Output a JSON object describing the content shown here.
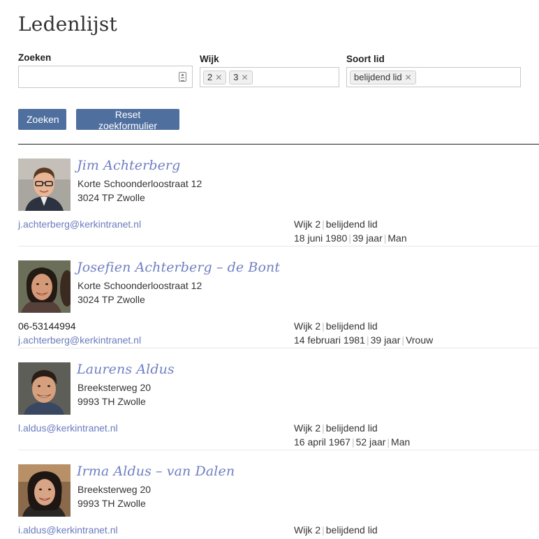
{
  "page": {
    "title": "Ledenlijst"
  },
  "search": {
    "label": "Zoeken",
    "value": "",
    "placeholder": ""
  },
  "wijk": {
    "label": "Wijk",
    "selected": [
      "2",
      "3"
    ]
  },
  "soort": {
    "label": "Soort lid",
    "selected": [
      "belijdend lid"
    ]
  },
  "buttons": {
    "search": "Zoeken",
    "reset": "Reset zoekformulier"
  },
  "members": [
    {
      "name": "Jim Achterberg",
      "street": "Korte Schoonderloostraat 12",
      "city": "3024 TP Zwolle",
      "phone": "",
      "email": "j.achterberg@kerkintranet.nl",
      "wijk": "Wijk 2",
      "soort": "belijdend lid",
      "birthdate": "18 juni 1980",
      "age": "39 jaar",
      "gender": "Man"
    },
    {
      "name": "Josefien Achterberg – de Bont",
      "street": "Korte Schoonderloostraat 12",
      "city": "3024 TP Zwolle",
      "phone": "06-53144994",
      "email": "j.achterberg@kerkintranet.nl",
      "wijk": "Wijk 2",
      "soort": "belijdend lid",
      "birthdate": "14 februari 1981",
      "age": "39 jaar",
      "gender": "Vrouw"
    },
    {
      "name": "Laurens Aldus",
      "street": "Breeksterweg 20",
      "city": "9993 TH Zwolle",
      "phone": "",
      "email": "l.aldus@kerkintranet.nl",
      "wijk": "Wijk 2",
      "soort": "belijdend lid",
      "birthdate": "16 april 1967",
      "age": "52 jaar",
      "gender": "Man"
    },
    {
      "name": "Irma Aldus – van Dalen",
      "street": "Breeksterweg 20",
      "city": "9993 TH Zwolle",
      "phone": "",
      "email": "i.aldus@kerkintranet.nl",
      "wijk": "Wijk 2",
      "soort": "belijdend lid",
      "birthdate": "",
      "age": "",
      "gender": ""
    }
  ],
  "colors": {
    "accent_button": "#4f6f9f",
    "name_link": "#6f7fc2",
    "email_link": "#6a7bbf"
  }
}
